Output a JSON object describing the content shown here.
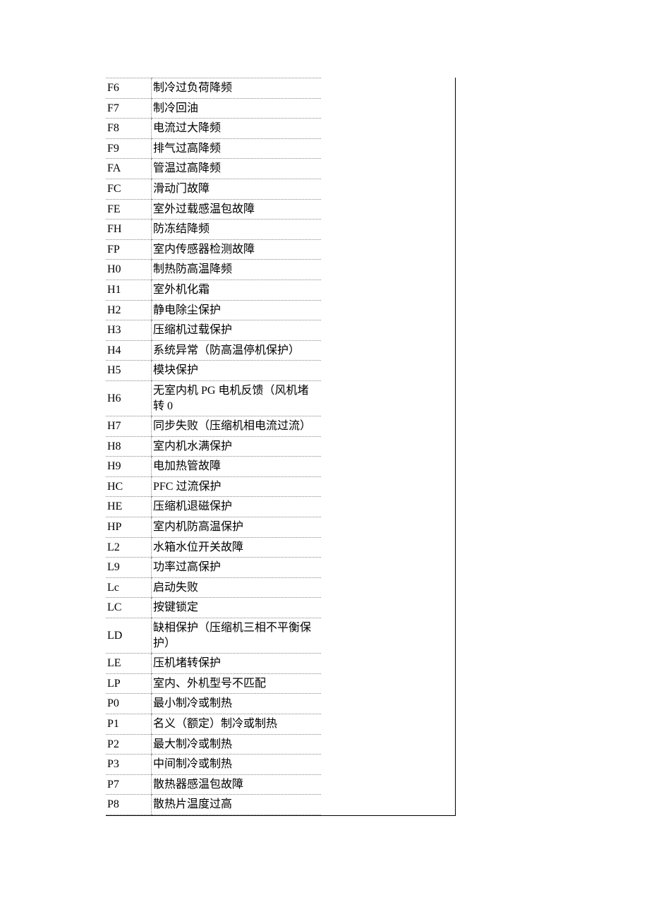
{
  "rows": [
    {
      "code": "F6",
      "desc": "制冷过负荷降频"
    },
    {
      "code": "F7",
      "desc": "制冷回油"
    },
    {
      "code": "F8",
      "desc": "电流过大降频"
    },
    {
      "code": "F9",
      "desc": "排气过高降频"
    },
    {
      "code": "FA",
      "desc": "管温过高降频"
    },
    {
      "code": "FC",
      "desc": "滑动门故障"
    },
    {
      "code": "FE",
      "desc": "室外过载感温包故障"
    },
    {
      "code": "FH",
      "desc": "防冻结降频"
    },
    {
      "code": "FP",
      "desc": "室内传感器检测故障"
    },
    {
      "code": "H0",
      "desc": "制热防高温降频"
    },
    {
      "code": "H1",
      "desc": "室外机化霜"
    },
    {
      "code": "H2",
      "desc": "静电除尘保护"
    },
    {
      "code": "H3",
      "desc": "压缩机过载保护"
    },
    {
      "code": "H4",
      "desc": "系统异常（防高温停机保护）"
    },
    {
      "code": "H5",
      "desc": "模块保护"
    },
    {
      "code": "H6",
      "desc": "无室内机 PG 电机反馈（风机堵转 0"
    },
    {
      "code": "H7",
      "desc": "同步失败（压缩机相电流过流）"
    },
    {
      "code": "H8",
      "desc": "室内机水满保护"
    },
    {
      "code": "H9",
      "desc": "电加热管故障"
    },
    {
      "code": "HC",
      "desc": "PFC 过流保护"
    },
    {
      "code": "HE",
      "desc": "压缩机退磁保护"
    },
    {
      "code": "HP",
      "desc": "室内机防高温保护"
    },
    {
      "code": "L2",
      "desc": "水箱水位开关故障"
    },
    {
      "code": "L9",
      "desc": "功率过高保护"
    },
    {
      "code": "Lc",
      "desc": "启动失败"
    },
    {
      "code": "LC",
      "desc": "按键锁定"
    },
    {
      "code": "LD",
      "desc": "缺相保护（压缩机三相不平衡保护）"
    },
    {
      "code": "LE",
      "desc": "压机堵转保护"
    },
    {
      "code": "LP",
      "desc": "室内、外机型号不匹配"
    },
    {
      "code": "P0",
      "desc": "最小制冷或制热"
    },
    {
      "code": "P1",
      "desc": "名义（额定）制冷或制热"
    },
    {
      "code": "P2",
      "desc": "最大制冷或制热"
    },
    {
      "code": "P3",
      "desc": "中间制冷或制热"
    },
    {
      "code": "P7",
      "desc": "散热器感温包故障"
    },
    {
      "code": "P8",
      "desc": "散热片温度过高"
    }
  ]
}
